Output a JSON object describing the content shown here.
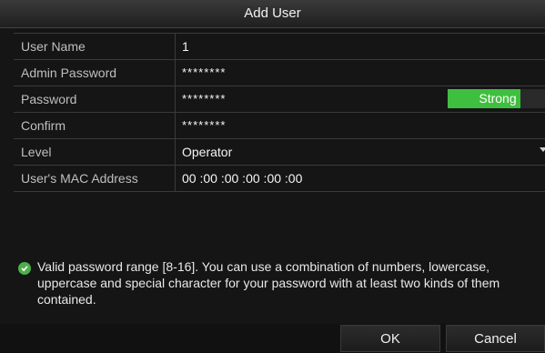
{
  "window": {
    "title": "Add User"
  },
  "form": {
    "user_name": {
      "label": "User Name",
      "value": "1"
    },
    "admin_password": {
      "label": "Admin Password",
      "value": "********"
    },
    "password": {
      "label": "Password",
      "value": "********",
      "strength": "Strong",
      "strength_color": "#3fbf3f"
    },
    "confirm": {
      "label": "Confirm",
      "value": "********"
    },
    "level": {
      "label": "Level",
      "value": "Operator"
    },
    "mac": {
      "label": "User's MAC Address",
      "segments": [
        "00",
        "00",
        "00",
        "00",
        "00",
        "00"
      ]
    }
  },
  "hint": {
    "icon": "check-circle-icon",
    "text": "Valid password range [8-16]. You can use a combination of numbers, lowercase, uppercase and special character for your password with at least two kinds of them contained."
  },
  "buttons": {
    "ok": "OK",
    "cancel": "Cancel"
  }
}
